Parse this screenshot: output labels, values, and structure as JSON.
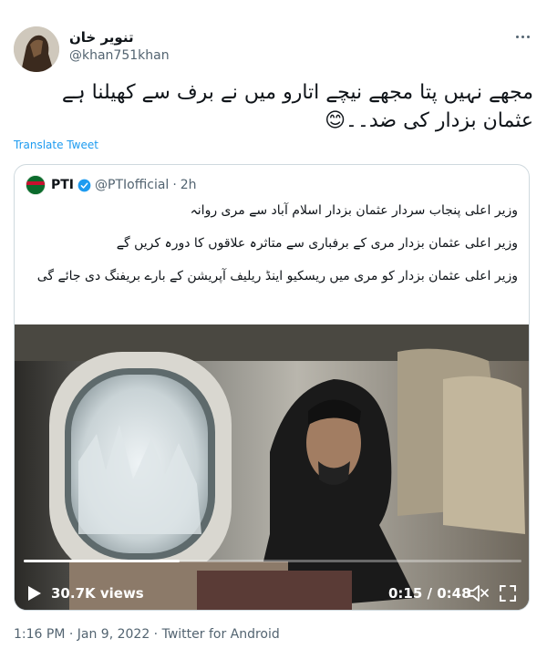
{
  "author": {
    "name": "تنویر خان",
    "handle": "@khan751khan"
  },
  "tweet": {
    "text": "مجھے نہیں پتا مجھے نیچے اتارو میں نے برف سے کھیلنا ہے عثمان بزدار کی ضد۔۔😊",
    "translate_label": "Translate Tweet"
  },
  "quoted": {
    "name": "PTI",
    "handle": "@PTIofficial",
    "separator": "·",
    "time": "2h",
    "lines": [
      "وزیر اعلی پنجاب سردار عثمان بزدار اسلام آباد سے مری روانہ",
      "وزیر اعلی عثمان بزدار مری کے برفباری سے متاثرہ علاقوں کا دورہ کریں گے",
      "وزیر اعلی عثمان بزدار کو مری میں ریسکیو اینڈ ریلیف آپریشن کے بارے بریفنگ دی جائے گی"
    ]
  },
  "video": {
    "views": "30.7K views",
    "time": "0:15 / 0:48",
    "progress": 0.3125
  },
  "meta": "1:16 PM · Jan 9, 2022 · Twitter for Android",
  "colors": {
    "link": "#1d9bf0",
    "secondary": "#536471",
    "border": "#cfd9de",
    "verified": "#1d9bf0"
  }
}
